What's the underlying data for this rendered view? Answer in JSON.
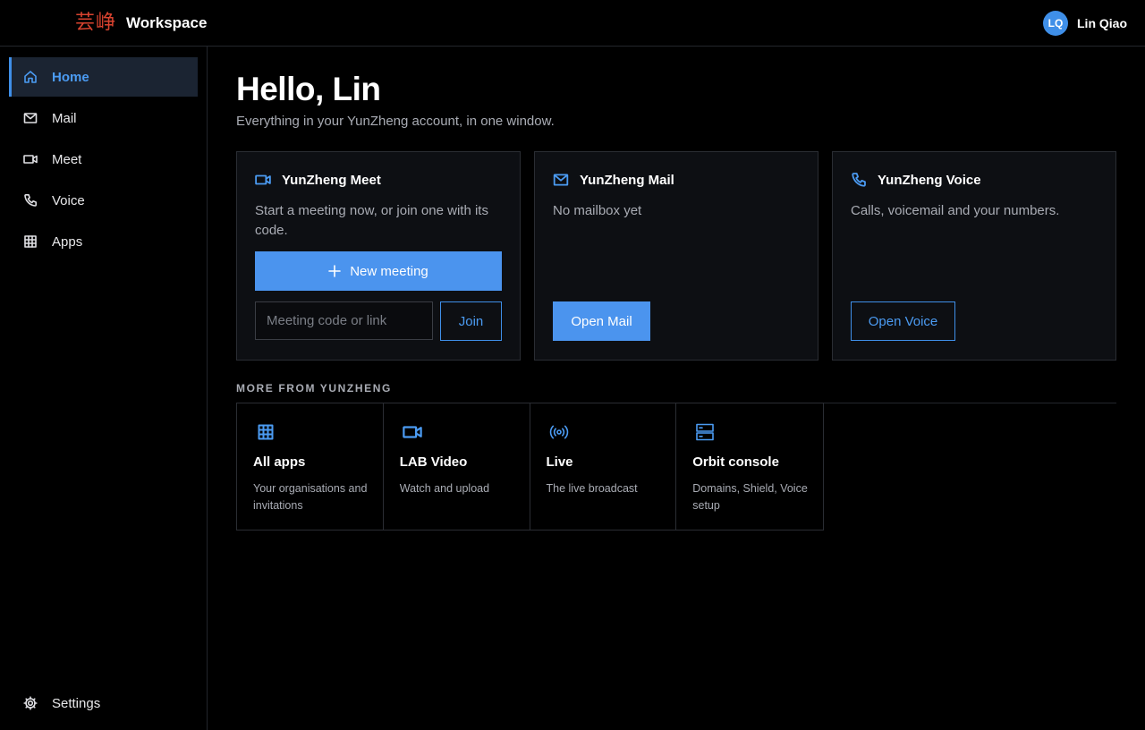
{
  "header": {
    "logo_text": "芸峥",
    "app_name": "Workspace",
    "user_initials": "LQ",
    "user_name": "Lin Qiao"
  },
  "sidebar": {
    "items": [
      {
        "label": "Home",
        "icon": "home-icon",
        "active": true
      },
      {
        "label": "Mail",
        "icon": "mail-icon"
      },
      {
        "label": "Meet",
        "icon": "video-icon"
      },
      {
        "label": "Voice",
        "icon": "phone-icon"
      },
      {
        "label": "Apps",
        "icon": "grid-icon"
      }
    ],
    "settings_label": "Settings"
  },
  "main": {
    "greeting": "Hello, Lin",
    "subtitle": "Everything in your YunZheng account, in one window.",
    "cards": {
      "meet": {
        "title": "YunZheng Meet",
        "text": "Start a meeting now, or join one with its code.",
        "new_meeting_label": "New meeting",
        "code_placeholder": "Meeting code or link",
        "join_label": "Join"
      },
      "mail": {
        "title": "YunZheng Mail",
        "text": "No mailbox yet",
        "button_label": "Open Mail"
      },
      "voice": {
        "title": "YunZheng Voice",
        "text": "Calls, voicemail and your numbers.",
        "button_label": "Open Voice"
      }
    },
    "more_label": "MORE FROM YUNZHENG",
    "tiles": [
      {
        "title": "All apps",
        "desc": "Your organisations and invitations",
        "icon": "grid-icon"
      },
      {
        "title": "LAB Video",
        "desc": "Watch and upload",
        "icon": "video-icon"
      },
      {
        "title": "Live",
        "desc": "The live broadcast",
        "icon": "broadcast-icon"
      },
      {
        "title": "Orbit console",
        "desc": "Domains, Shield, Voice setup",
        "icon": "server-icon"
      }
    ]
  },
  "colors": {
    "accent": "#4b94ee",
    "background": "#000000",
    "card_bg": "#0d0f13",
    "logo": "#d9432f"
  }
}
